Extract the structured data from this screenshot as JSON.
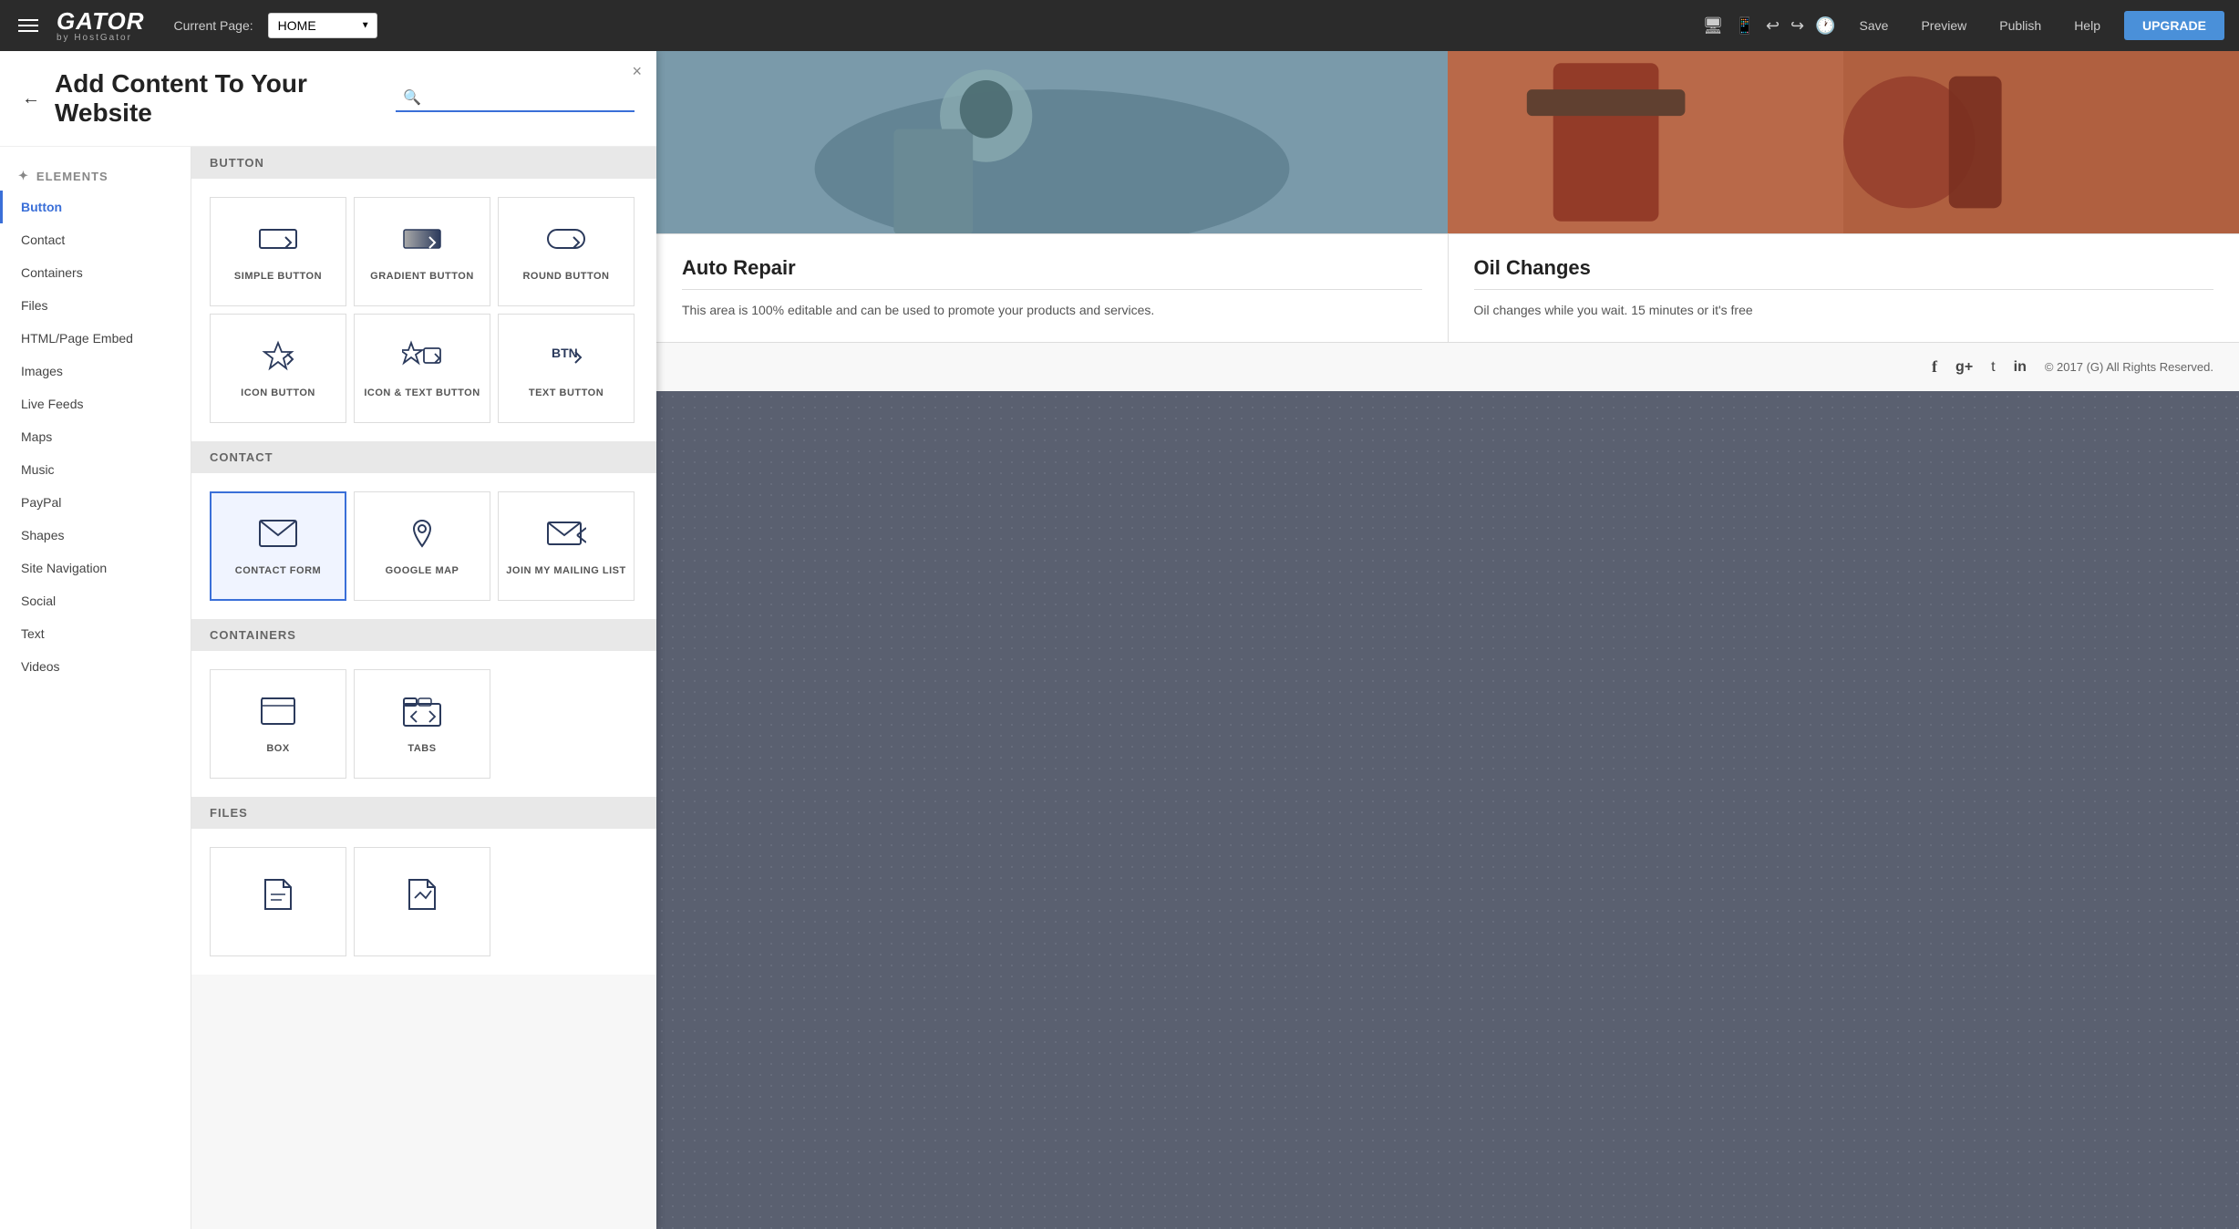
{
  "navbar": {
    "hamburger_label": "Menu",
    "logo_main": "GATOR",
    "logo_sub": "by HostGator",
    "current_page_label": "Current Page:",
    "page_options": [
      "HOME"
    ],
    "selected_page": "HOME",
    "icon_monitor": "🖥",
    "icon_tablet": "📱",
    "undo_icon": "↩",
    "redo_icon": "↪",
    "history_icon": "🕐",
    "save_btn": "Save",
    "preview_btn": "Preview",
    "publish_btn": "Publish",
    "help_btn": "Help",
    "upgrade_btn": "UPGRADE"
  },
  "panel": {
    "back_icon": "←",
    "title": "Add Content To Your Website",
    "search_placeholder": "|",
    "close_icon": "×"
  },
  "sidebar": {
    "section_label": "ELEMENTS",
    "section_icon": "✦",
    "items": [
      {
        "label": "Button",
        "active": true
      },
      {
        "label": "Contact",
        "active": false
      },
      {
        "label": "Containers",
        "active": false
      },
      {
        "label": "Files",
        "active": false
      },
      {
        "label": "HTML/Page Embed",
        "active": false
      },
      {
        "label": "Images",
        "active": false
      },
      {
        "label": "Live Feeds",
        "active": false
      },
      {
        "label": "Maps",
        "active": false
      },
      {
        "label": "Music",
        "active": false
      },
      {
        "label": "PayPal",
        "active": false
      },
      {
        "label": "Shapes",
        "active": false
      },
      {
        "label": "Site Navigation",
        "active": false
      },
      {
        "label": "Social",
        "active": false
      },
      {
        "label": "Text",
        "active": false
      },
      {
        "label": "Videos",
        "active": false
      }
    ]
  },
  "content": {
    "sections": [
      {
        "id": "button",
        "label": "BUTTON",
        "items": [
          {
            "id": "simple-button",
            "label": "SIMPLE BUTTON",
            "icon": "simple_btn"
          },
          {
            "id": "gradient-button",
            "label": "GRADIENT BUTTON",
            "icon": "gradient_btn"
          },
          {
            "id": "round-button",
            "label": "ROUND BUTTON",
            "icon": "round_btn"
          },
          {
            "id": "icon-button",
            "label": "ICON BUTTON",
            "icon": "icon_btn"
          },
          {
            "id": "icon-text-button",
            "label": "ICON & TEXT BUTTON",
            "icon": "icon_text_btn"
          },
          {
            "id": "text-button",
            "label": "TEXT BUTTON",
            "icon": "text_btn"
          }
        ]
      },
      {
        "id": "contact",
        "label": "CONTACT",
        "items": [
          {
            "id": "contact-form",
            "label": "CONTACT FORM",
            "icon": "contact_form",
            "selected": true
          },
          {
            "id": "google-map",
            "label": "GOOGLE MAP",
            "icon": "google_map"
          },
          {
            "id": "mailing-list",
            "label": "JOIN MY MAILING LIST",
            "icon": "mailing_list"
          }
        ]
      },
      {
        "id": "containers",
        "label": "CONTAINERS",
        "items": [
          {
            "id": "box",
            "label": "BOX",
            "icon": "box"
          },
          {
            "id": "tabs",
            "label": "TABS",
            "icon": "tabs"
          }
        ]
      },
      {
        "id": "files",
        "label": "FILES",
        "items": [
          {
            "id": "file1",
            "label": "",
            "icon": "file1"
          },
          {
            "id": "file2",
            "label": "",
            "icon": "file2"
          }
        ]
      }
    ]
  },
  "preview": {
    "card1_title": "Auto Repair",
    "card1_text": "This area is 100% editable and can be used to promote your products and services.",
    "card2_title": "Oil Changes",
    "card2_text": "Oil changes while you wait. 15 minutes or it's free",
    "footer_copyright": "© 2017  (G)  All Rights Reserved.",
    "social_icons": [
      "f",
      "g+",
      "t",
      "in"
    ]
  }
}
